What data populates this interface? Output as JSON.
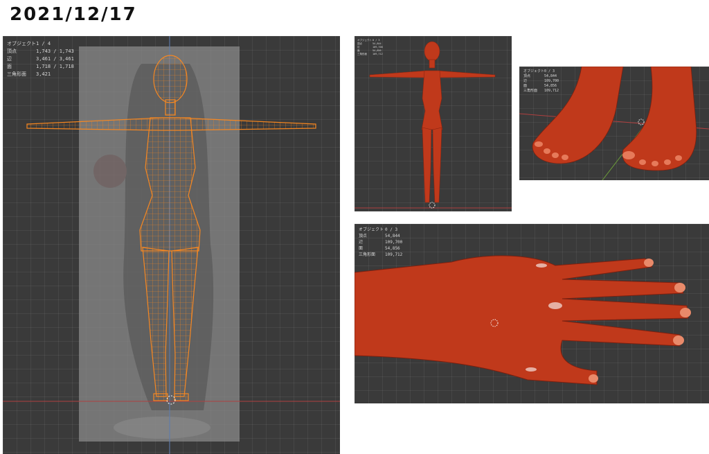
{
  "title": "2021/12/17",
  "panel_wire": {
    "stats": [
      {
        "label": "オブジェクト",
        "value": "1 / 4"
      },
      {
        "label": "頂点",
        "value": "1,743 / 1,743"
      },
      {
        "label": "辺",
        "value": "3,461 / 3,461"
      },
      {
        "label": "面",
        "value": "1,718 / 1,718"
      },
      {
        "label": "三角形面",
        "value": "3,421"
      }
    ]
  },
  "panel_body": {
    "stats": [
      {
        "label": "オブジェクト",
        "value": "0 / 3"
      },
      {
        "label": "頂点",
        "value": "54,844"
      },
      {
        "label": "辺",
        "value": "109,700"
      },
      {
        "label": "面",
        "value": "54,856"
      },
      {
        "label": "三角形面",
        "value": "109,712"
      }
    ]
  },
  "panel_feet": {
    "stats": [
      {
        "label": "オブジェクト",
        "value": "0 / 3"
      },
      {
        "label": "頂点",
        "value": "54,844"
      },
      {
        "label": "辺",
        "value": "109,700"
      },
      {
        "label": "面",
        "value": "54,856"
      },
      {
        "label": "三角形面",
        "value": "109,712"
      }
    ]
  },
  "panel_hand": {
    "stats": [
      {
        "label": "オブジェクト",
        "value": "0 / 3"
      },
      {
        "label": "頂点",
        "value": "54,844"
      },
      {
        "label": "辺",
        "value": "109,700"
      },
      {
        "label": "面",
        "value": "54,856"
      },
      {
        "label": "三角形面",
        "value": "109,712"
      }
    ]
  },
  "colors": {
    "viewport": "#3a3a3a",
    "wire": "#ff8a1e",
    "skin": "#c0391b"
  }
}
